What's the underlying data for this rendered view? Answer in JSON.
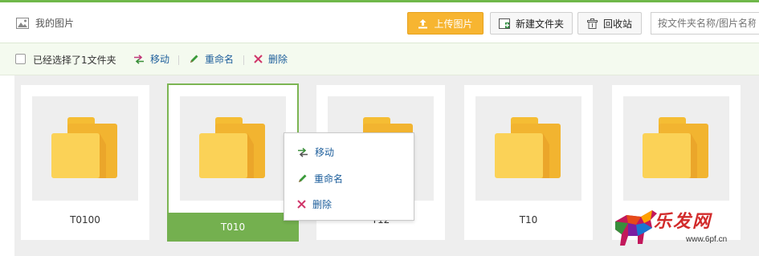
{
  "header": {
    "title": "我的图片",
    "upload_label": "上传图片",
    "new_folder_label": "新建文件夹",
    "recycle_label": "回收站",
    "search_placeholder": "按文件夹名称/图片名称"
  },
  "toolbar": {
    "selection_text": "已经选择了1文件夹",
    "move_label": "移动",
    "rename_label": "重命名",
    "delete_label": "删除"
  },
  "folders": [
    {
      "name": "T0100",
      "selected": false
    },
    {
      "name": "T010",
      "selected": true
    },
    {
      "name": "T12",
      "selected": false
    },
    {
      "name": "T10",
      "selected": false
    },
    {
      "name": "",
      "selected": false
    }
  ],
  "context_menu": {
    "move_label": "移动",
    "rename_label": "重命名",
    "delete_label": "删除"
  },
  "watermark": {
    "text": "乐发网",
    "url": "www.6pf.cn"
  },
  "colors": {
    "accent_green": "#74b04f",
    "upload_orange": "#f7b531",
    "folder_yellow": "#f6c642",
    "link_blue": "#1d5e9b",
    "delete_red": "#d0366a"
  },
  "icons": {
    "title": "image-icon",
    "upload": "upload-icon",
    "new_folder": "folder-plus-icon",
    "recycle": "trash-icon",
    "move": "move-arrows-icon",
    "rename": "pencil-icon",
    "delete": "close-x-icon",
    "folder": "folder-icon"
  }
}
